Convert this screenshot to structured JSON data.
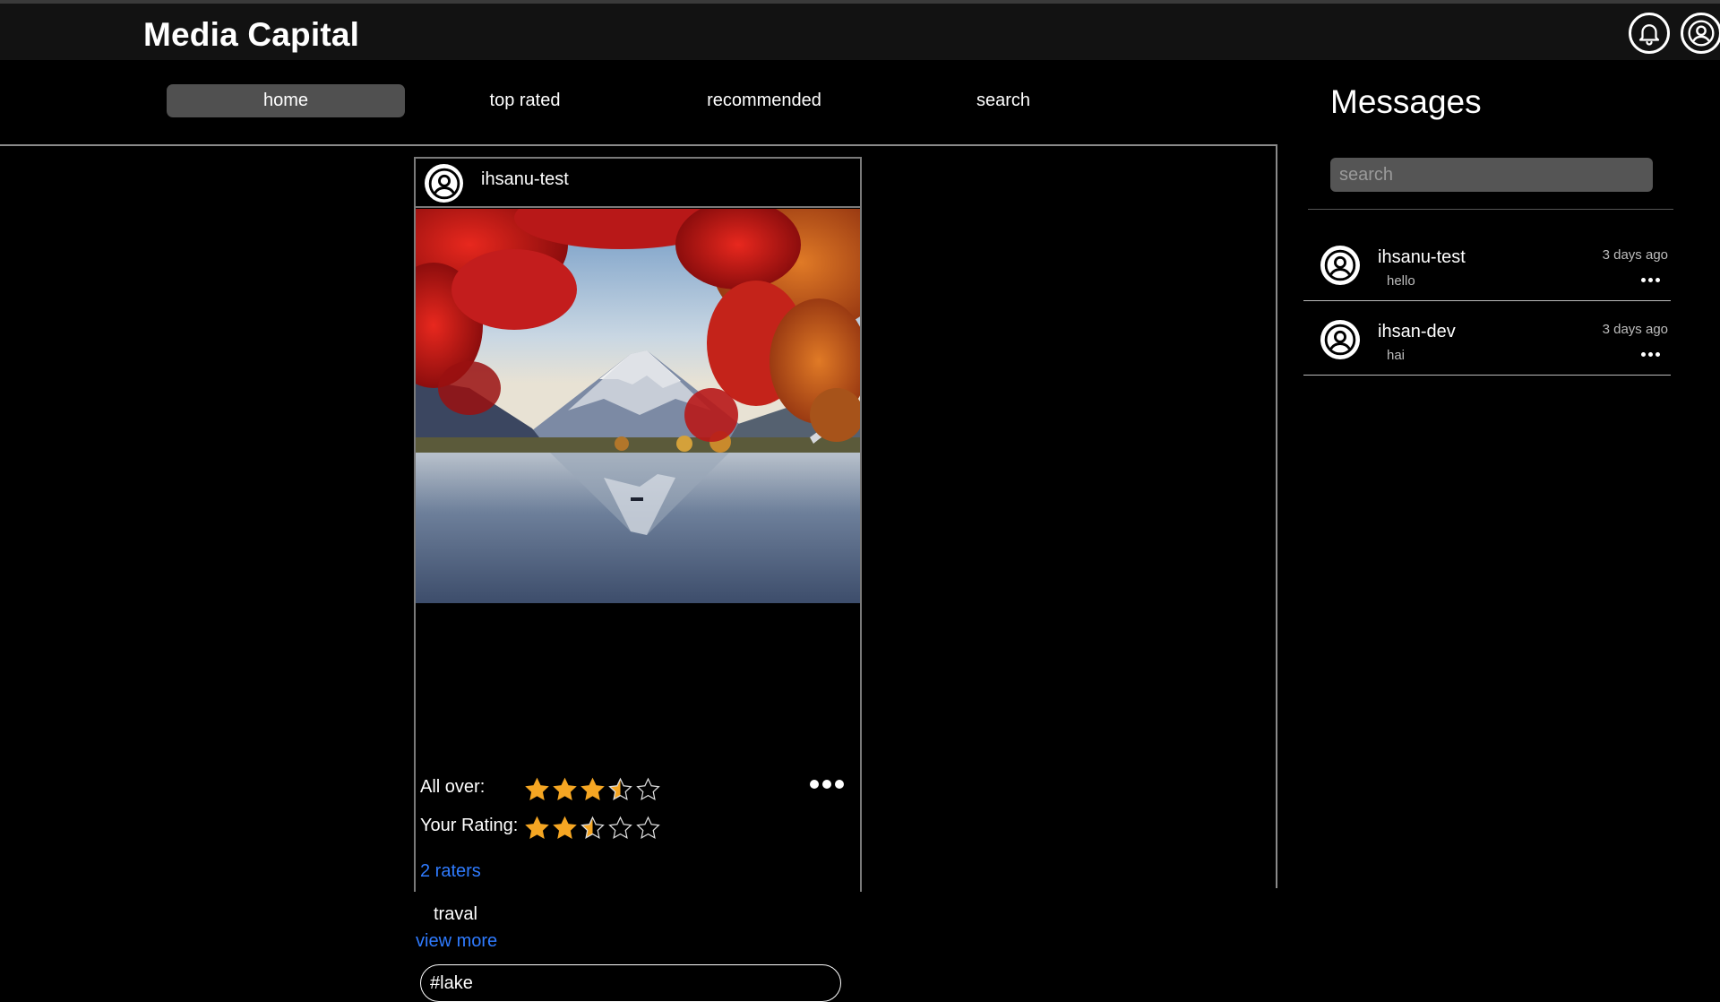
{
  "app": {
    "brand": "Media Capital"
  },
  "header": {
    "icons": [
      "bell-icon",
      "account-icon"
    ]
  },
  "nav": {
    "tabs": [
      {
        "label": "home",
        "active": true
      },
      {
        "label": "top rated",
        "active": false
      },
      {
        "label": "recommended",
        "active": false
      },
      {
        "label": "search",
        "active": false
      }
    ]
  },
  "post": {
    "username": "ihsanu-test",
    "image_alt_icon": "landscape-photo",
    "overall_label": "All over:",
    "overall_rating": 3.5,
    "your_label": "Your Rating:",
    "your_rating": 2.5,
    "max_rating": 5,
    "raters": "2 raters",
    "caption": "traval",
    "view_more": "view more",
    "tag": "#lake"
  },
  "messages": {
    "title": "Messages",
    "search_placeholder": "search",
    "conversations": [
      {
        "name": "ihsanu-test",
        "preview": "hello",
        "time": "3 days ago"
      },
      {
        "name": "ihsan-dev",
        "preview": "hai",
        "time": "3 days ago"
      }
    ]
  },
  "colors": {
    "link": "#2f7bff",
    "star": "#f5a623",
    "active_tab": "#505050"
  }
}
